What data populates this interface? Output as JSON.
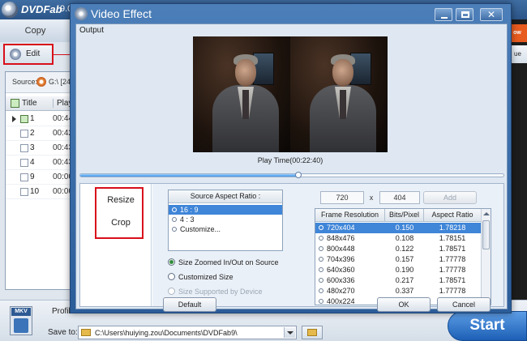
{
  "app": {
    "name": "DVDFab",
    "version": "9.0",
    "copy_tab": "Copy",
    "edit_button": "Edit",
    "source_label": "Source:",
    "source_path": "G:\\ [24_",
    "table_headers": {
      "title": "Title",
      "play": "Play"
    },
    "titles": [
      {
        "num": "1",
        "time": "00:44",
        "checked": true,
        "current": true
      },
      {
        "num": "2",
        "time": "00:42",
        "checked": false,
        "current": false
      },
      {
        "num": "3",
        "time": "00:43",
        "checked": false,
        "current": false
      },
      {
        "num": "4",
        "time": "00:43",
        "checked": false,
        "current": false
      },
      {
        "num": "9",
        "time": "00:00",
        "checked": false,
        "current": false
      },
      {
        "num": "10",
        "time": "00:00",
        "checked": false,
        "current": false
      }
    ],
    "profile_label": "Profile",
    "profile_badge": "MKV",
    "save_to_label": "Save to:",
    "save_path": "C:\\Users\\huiying.zou\\Documents\\DVDFab9\\",
    "start_button": "Start",
    "right_tab_1": "ow",
    "right_tab_2": "ue"
  },
  "dialog": {
    "title": "Video Effect",
    "output_label": "Output",
    "play_time": "Play Time(00:22:40)",
    "seek_fraction": 0.515,
    "tabs": [
      {
        "label": "Resize"
      },
      {
        "label": "Crop"
      }
    ],
    "aspect": {
      "header": "Source Aspect Ratio :",
      "options": [
        {
          "label": "16 : 9",
          "selected": true
        },
        {
          "label": "4 : 3",
          "selected": false
        },
        {
          "label": "Customize...",
          "selected": false
        }
      ]
    },
    "size_mode": {
      "zoomed": "Size Zoomed In/Out on Source",
      "custom": "Customized Size",
      "device": "Size Supported by Device"
    },
    "width": "720",
    "size_separator": "x",
    "height": "404",
    "add_button": "Add",
    "resolution_table": {
      "headers": [
        "Frame Resolution",
        "Bits/Pixel",
        "Aspect Ratio"
      ],
      "rows": [
        [
          "720x404",
          "0.150",
          "1.78218"
        ],
        [
          "848x476",
          "0.108",
          "1.78151"
        ],
        [
          "800x448",
          "0.122",
          "1.78571"
        ],
        [
          "704x396",
          "0.157",
          "1.77778"
        ],
        [
          "640x360",
          "0.190",
          "1.77778"
        ],
        [
          "600x336",
          "0.217",
          "1.78571"
        ],
        [
          "480x270",
          "0.337",
          "1.77778"
        ],
        [
          "400x224",
          "0.487",
          "1.78571"
        ]
      ],
      "selected_index": 0
    },
    "buttons": {
      "default": "Default",
      "ok": "OK",
      "cancel": "Cancel"
    }
  }
}
